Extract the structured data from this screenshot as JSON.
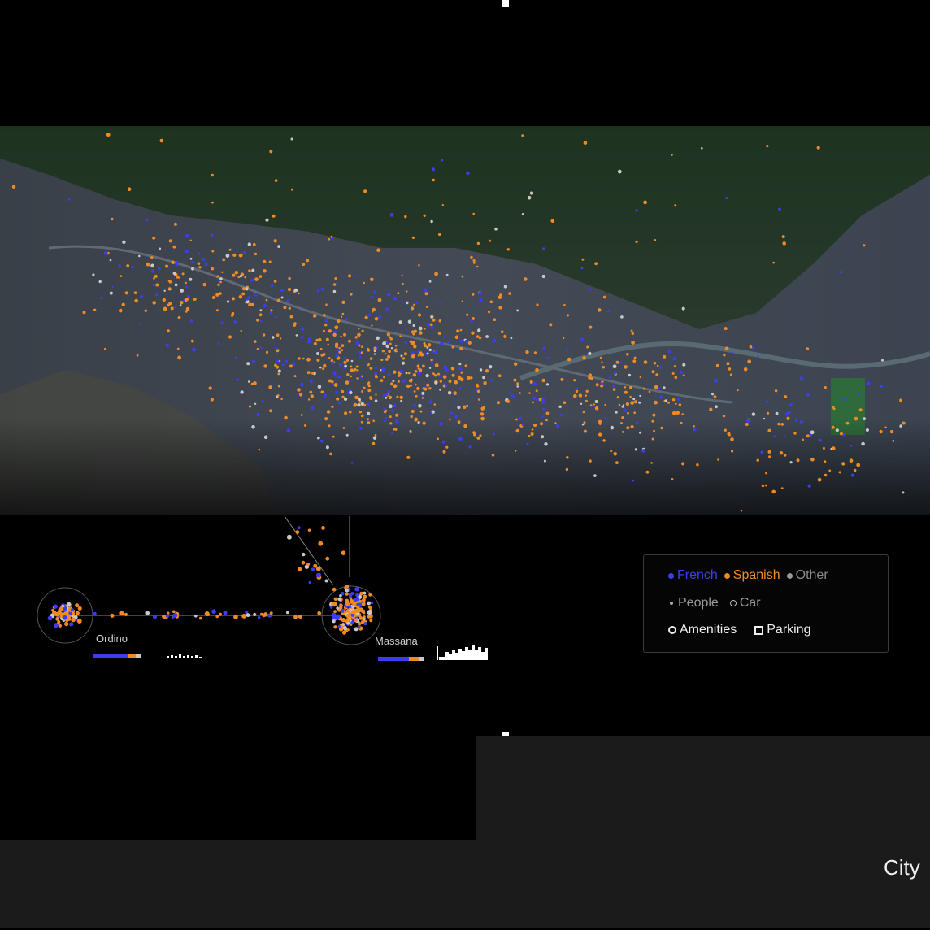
{
  "labels": {
    "town_1": "Ordino",
    "town_2": "Massana",
    "city": "City"
  },
  "legend": {
    "french": "French",
    "spanish": "Spanish",
    "other": "Other",
    "people": "People",
    "car": "Car",
    "amenities": "Amenities",
    "parking": "Parking"
  },
  "colors": {
    "french": "#3d3df0",
    "spanish": "#f08a24",
    "other": "#c8c8c8",
    "background": "#000000"
  },
  "icons": [
    "french-dot-icon",
    "spanish-dot-icon",
    "other-dot-icon",
    "people-icon",
    "car-icon",
    "amenities-icon",
    "parking-icon"
  ]
}
